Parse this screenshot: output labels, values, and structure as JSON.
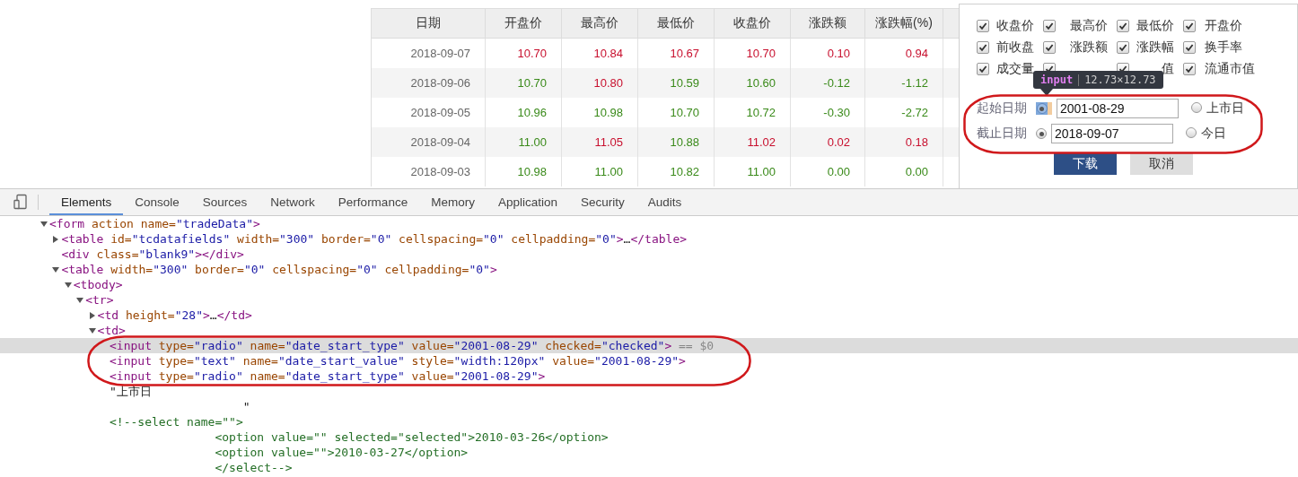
{
  "table": {
    "columns": [
      "日期",
      "开盘价",
      "最高价",
      "最低价",
      "收盘价",
      "涨跌额",
      "涨跌幅(%)"
    ],
    "rows": [
      {
        "cells": [
          {
            "text": "2018-09-07"
          },
          {
            "text": "10.70",
            "color": "#c8102e"
          },
          {
            "text": "10.84",
            "color": "#c8102e"
          },
          {
            "text": "10.67",
            "color": "#c8102e"
          },
          {
            "text": "10.70",
            "color": "#c8102e"
          },
          {
            "text": "0.10",
            "color": "#c8102e"
          },
          {
            "text": "0.94",
            "color": "#c8102e"
          }
        ]
      },
      {
        "cells": [
          {
            "text": "2018-09-06"
          },
          {
            "text": "10.70",
            "color": "#3a8a1a"
          },
          {
            "text": "10.80",
            "color": "#c8102e"
          },
          {
            "text": "10.59",
            "color": "#3a8a1a"
          },
          {
            "text": "10.60",
            "color": "#3a8a1a"
          },
          {
            "text": "-0.12",
            "color": "#3a8a1a"
          },
          {
            "text": "-1.12",
            "color": "#3a8a1a"
          }
        ]
      },
      {
        "cells": [
          {
            "text": "2018-09-05"
          },
          {
            "text": "10.96",
            "color": "#3a8a1a"
          },
          {
            "text": "10.98",
            "color": "#3a8a1a"
          },
          {
            "text": "10.70",
            "color": "#3a8a1a"
          },
          {
            "text": "10.72",
            "color": "#3a8a1a"
          },
          {
            "text": "-0.30",
            "color": "#3a8a1a"
          },
          {
            "text": "-2.72",
            "color": "#3a8a1a"
          }
        ]
      },
      {
        "cells": [
          {
            "text": "2018-09-04"
          },
          {
            "text": "11.00",
            "color": "#3a8a1a"
          },
          {
            "text": "11.05",
            "color": "#c8102e"
          },
          {
            "text": "10.88",
            "color": "#3a8a1a"
          },
          {
            "text": "11.02",
            "color": "#c8102e"
          },
          {
            "text": "0.02",
            "color": "#c8102e"
          },
          {
            "text": "0.18",
            "color": "#c8102e"
          }
        ]
      },
      {
        "cells": [
          {
            "text": "2018-09-03"
          },
          {
            "text": "10.98",
            "color": "#3a8a1a"
          },
          {
            "text": "11.00",
            "color": "#3a8a1a"
          },
          {
            "text": "10.82",
            "color": "#3a8a1a"
          },
          {
            "text": "11.00",
            "color": "#3a8a1a"
          },
          {
            "text": "0.00",
            "color": "#3a8a1a"
          },
          {
            "text": "0.00",
            "color": "#3a8a1a"
          }
        ]
      }
    ]
  },
  "popup": {
    "fields": [
      {
        "label": "收盘价",
        "checked": true
      },
      {
        "label": "最高价",
        "checked": true
      },
      {
        "label": "最低价",
        "checked": true
      },
      {
        "label": "开盘价",
        "checked": true
      },
      {
        "label": "前收盘",
        "checked": true
      },
      {
        "label": "涨跌额",
        "checked": true
      },
      {
        "label": "涨跌幅",
        "checked": true
      },
      {
        "label": "换手率",
        "checked": true
      },
      {
        "label": "成交量",
        "checked": true
      },
      {
        "checked": true
      },
      {
        "label": "值",
        "checked": true
      },
      {
        "label": "流通市值",
        "checked": true
      }
    ],
    "tooltip": {
      "tag": "input",
      "size": "12.73×12.73"
    },
    "dates": [
      {
        "label": "起始日期",
        "radio": {
          "checked": true,
          "inspected": true
        },
        "value": "2001-08-29",
        "option": {
          "label": "上市日",
          "checked": false
        }
      },
      {
        "label": "截止日期",
        "radio": {
          "checked": true,
          "inspected": false
        },
        "value": "2018-09-07",
        "option": {
          "label": "今日",
          "checked": false
        }
      }
    ],
    "buttons": [
      {
        "label": "下载",
        "kind": "primary"
      },
      {
        "label": "取消",
        "kind": "secondary"
      }
    ]
  },
  "devtools": {
    "tabs": [
      {
        "label": "Elements",
        "selected": true
      },
      {
        "label": "Console",
        "selected": false
      },
      {
        "label": "Sources",
        "selected": false
      },
      {
        "label": "Network",
        "selected": false
      },
      {
        "label": "Performance",
        "selected": false
      },
      {
        "label": "Memory",
        "selected": false
      },
      {
        "label": "Application",
        "selected": false
      },
      {
        "label": "Security",
        "selected": false
      },
      {
        "label": "Audits",
        "selected": false
      }
    ],
    "tree": [
      {
        "expanded": true,
        "selected": false,
        "tokens": [
          {
            "kind": "tag",
            "text": "<form"
          },
          {
            "kind": "attr",
            "text": " action"
          },
          {
            "kind": "attr",
            "text": " name="
          },
          {
            "kind": "value",
            "text": "\"tradeData\""
          },
          {
            "kind": "tag",
            "text": ">"
          }
        ],
        "children": [
          {
            "expanded": false,
            "selected": false,
            "tokens": [
              {
                "kind": "tag",
                "text": "<table"
              },
              {
                "kind": "attr",
                "text": " id="
              },
              {
                "kind": "value",
                "text": "\"tcdatafields\""
              },
              {
                "kind": "attr",
                "text": " width="
              },
              {
                "kind": "value",
                "text": "\"300\""
              },
              {
                "kind": "attr",
                "text": " border="
              },
              {
                "kind": "value",
                "text": "\"0\""
              },
              {
                "kind": "attr",
                "text": " cellspacing="
              },
              {
                "kind": "value",
                "text": "\"0\""
              },
              {
                "kind": "attr",
                "text": " cellpadding="
              },
              {
                "kind": "value",
                "text": "\"0\""
              },
              {
                "kind": "tag",
                "text": ">"
              },
              {
                "kind": "plain",
                "text": "…"
              },
              {
                "kind": "tag",
                "text": "</table>"
              }
            ]
          },
          {
            "selected": false,
            "tokens": [
              {
                "kind": "tag",
                "text": "<div"
              },
              {
                "kind": "attr",
                "text": " class="
              },
              {
                "kind": "value",
                "text": "\"blank9\""
              },
              {
                "kind": "tag",
                "text": "></div>"
              }
            ]
          },
          {
            "expanded": true,
            "selected": false,
            "tokens": [
              {
                "kind": "tag",
                "text": "<table"
              },
              {
                "kind": "attr",
                "text": " width="
              },
              {
                "kind": "value",
                "text": "\"300\""
              },
              {
                "kind": "attr",
                "text": " border="
              },
              {
                "kind": "value",
                "text": "\"0\""
              },
              {
                "kind": "attr",
                "text": " cellspacing="
              },
              {
                "kind": "value",
                "text": "\"0\""
              },
              {
                "kind": "attr",
                "text": " cellpadding="
              },
              {
                "kind": "value",
                "text": "\"0\""
              },
              {
                "kind": "tag",
                "text": ">"
              }
            ],
            "children": [
              {
                "expanded": true,
                "selected": false,
                "tokens": [
                  {
                    "kind": "tag",
                    "text": "<tbody>"
                  }
                ],
                "children": [
                  {
                    "expanded": true,
                    "selected": false,
                    "tokens": [
                      {
                        "kind": "tag",
                        "text": "<tr>"
                      }
                    ],
                    "children": [
                      {
                        "expanded": false,
                        "selected": false,
                        "tokens": [
                          {
                            "kind": "tag",
                            "text": "<td"
                          },
                          {
                            "kind": "attr",
                            "text": " height="
                          },
                          {
                            "kind": "value",
                            "text": "\"28\""
                          },
                          {
                            "kind": "tag",
                            "text": ">"
                          },
                          {
                            "kind": "plain",
                            "text": "…"
                          },
                          {
                            "kind": "tag",
                            "text": "</td>"
                          }
                        ]
                      },
                      {
                        "expanded": true,
                        "selected": false,
                        "tokens": [
                          {
                            "kind": "tag",
                            "text": "<td>"
                          }
                        ],
                        "children": [
                          {
                            "selected": true,
                            "tokens": [
                              {
                                "kind": "tag",
                                "text": "<input"
                              },
                              {
                                "kind": "attr",
                                "text": " type="
                              },
                              {
                                "kind": "value",
                                "text": "\"radio\""
                              },
                              {
                                "kind": "attr",
                                "text": " name="
                              },
                              {
                                "kind": "value",
                                "text": "\"date_start_type\""
                              },
                              {
                                "kind": "attr",
                                "text": " value="
                              },
                              {
                                "kind": "value",
                                "text": "\"2001-08-29\""
                              },
                              {
                                "kind": "attr",
                                "text": " checked="
                              },
                              {
                                "kind": "value",
                                "text": "\"checked\""
                              },
                              {
                                "kind": "tag",
                                "text": ">"
                              },
                              {
                                "kind": "marker",
                                "text": " == $0"
                              }
                            ]
                          },
                          {
                            "selected": false,
                            "tokens": [
                              {
                                "kind": "tag",
                                "text": "<input"
                              },
                              {
                                "kind": "attr",
                                "text": " type="
                              },
                              {
                                "kind": "value",
                                "text": "\"text\""
                              },
                              {
                                "kind": "attr",
                                "text": " name="
                              },
                              {
                                "kind": "value",
                                "text": "\"date_start_value\""
                              },
                              {
                                "kind": "attr",
                                "text": " style="
                              },
                              {
                                "kind": "value",
                                "text": "\"width:120px\""
                              },
                              {
                                "kind": "attr",
                                "text": " value="
                              },
                              {
                                "kind": "value",
                                "text": "\"2001-08-29\""
                              },
                              {
                                "kind": "tag",
                                "text": ">"
                              }
                            ]
                          },
                          {
                            "selected": false,
                            "tokens": [
                              {
                                "kind": "tag",
                                "text": "<input"
                              },
                              {
                                "kind": "attr",
                                "text": " type="
                              },
                              {
                                "kind": "value",
                                "text": "\"radio\""
                              },
                              {
                                "kind": "attr",
                                "text": " name="
                              },
                              {
                                "kind": "value",
                                "text": "\"date_start_type\""
                              },
                              {
                                "kind": "attr",
                                "text": " value="
                              },
                              {
                                "kind": "value",
                                "text": "\"2001-08-29\""
                              },
                              {
                                "kind": "tag",
                                "text": ">"
                              }
                            ]
                          },
                          {
                            "selected": false,
                            "tokens": [
                              {
                                "kind": "plain",
                                "text": "\"上市日\n                   \""
                              }
                            ]
                          },
                          {
                            "selected": false,
                            "tokens": [
                              {
                                "kind": "comment",
                                "text": "<!--select name=\"\">\n               <option value=\"\" selected=\"selected\">2010-03-26</option>\n               <option value=\"\">2010-03-27</option>\n               </select-->"
                              }
                            ]
                          }
                        ]
                      }
                    ]
                  }
                ]
              }
            ]
          }
        ]
      }
    ]
  }
}
